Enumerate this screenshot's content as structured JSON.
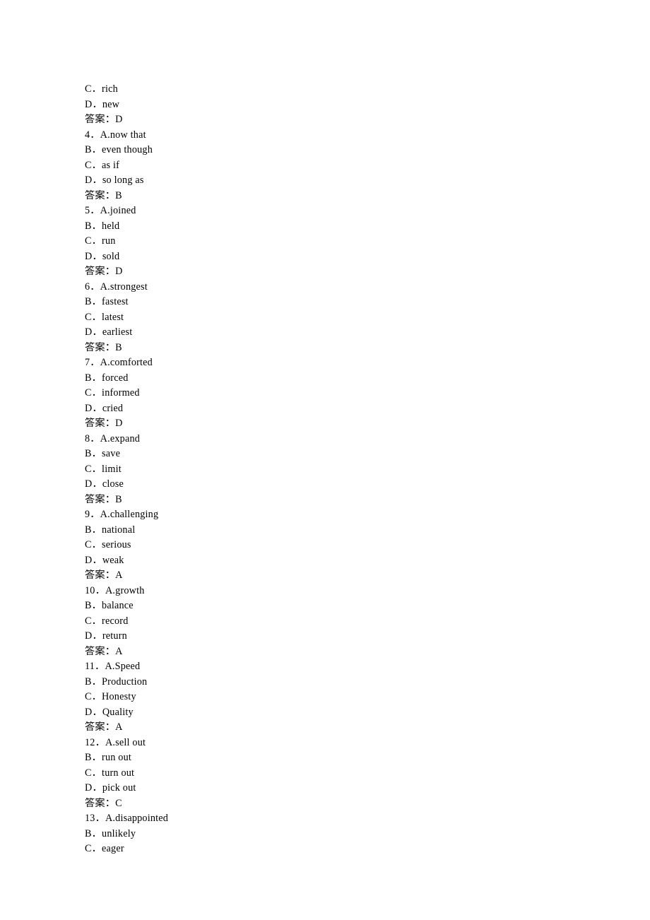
{
  "lines": [
    "C．rich",
    "D．new",
    "答案：D",
    "4．A.now that",
    "B．even though",
    "C．as if",
    "D．so long as",
    "答案：B",
    "5．A.joined",
    "B．held",
    "C．run",
    "D．sold",
    "答案：D",
    "6．A.strongest",
    "B．fastest",
    "C．latest",
    "D．earliest",
    "答案：B",
    "7．A.comforted",
    "B．forced",
    "C．informed",
    "D．cried",
    "答案：D",
    "8．A.expand",
    "B．save",
    "C．limit",
    "D．close",
    "答案：B",
    "9．A.challenging",
    "B．national",
    "C．serious",
    "D．weak",
    "答案：A",
    "10．A.growth",
    "B．balance",
    "C．record",
    "D．return",
    "答案：A",
    "11．A.Speed",
    "B．Production",
    "C．Honesty",
    "D．Quality",
    "答案：A",
    "12．A.sell out",
    "B．run out",
    "C．turn out",
    "D．pick out",
    "答案：C",
    "13．A.disappointed",
    "B．unlikely",
    "C．eager"
  ]
}
